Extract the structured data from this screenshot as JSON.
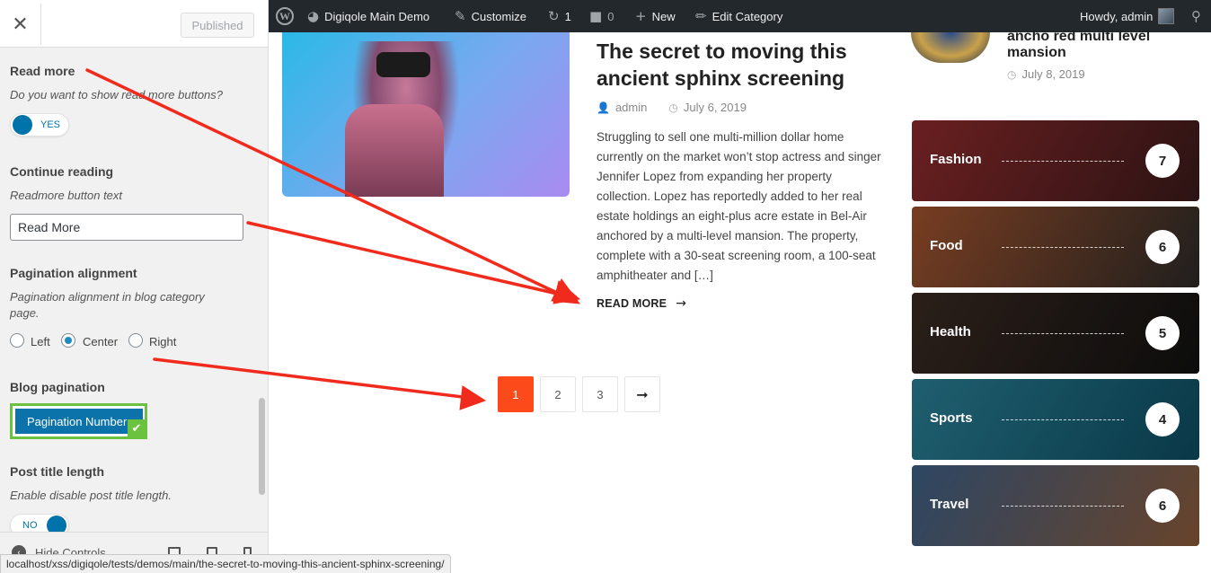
{
  "customizer": {
    "published_label": "Published",
    "sections": {
      "read_more": {
        "title": "Read more",
        "description": "Do you want to show read more buttons?",
        "toggle_label": "YES"
      },
      "continue_reading": {
        "title": "Continue reading",
        "description": "Readmore button text",
        "input_value": "Read More"
      },
      "pagination_alignment": {
        "title": "Pagination alignment",
        "description": "Pagination alignment in blog category page.",
        "options": [
          "Left",
          "Center",
          "Right"
        ],
        "selected": "Center"
      },
      "blog_pagination": {
        "title": "Blog pagination",
        "selected_label": "Pagination Number"
      },
      "post_title_length": {
        "title": "Post title length",
        "description": "Enable disable post title length.",
        "toggle_label": "NO"
      }
    },
    "footer": {
      "hide_controls": "Hide Controls"
    }
  },
  "adminbar": {
    "site_name": "Digiqole Main Demo",
    "customize": "Customize",
    "updates_count": "1",
    "comments_count": "0",
    "new_label": "New",
    "edit_label": "Edit Category",
    "howdy": "Howdy, admin"
  },
  "post": {
    "title": "The secret to moving this ancient sphinx screening",
    "author": "admin",
    "date": "July 6, 2019",
    "excerpt": "Struggling to sell one multi-million dollar home currently on the market won’t stop actress and singer Jennifer Lopez from expanding her property collection. Lopez has reportedly added to her real estate holdings an eight-plus acre estate in Bel-Air anchored by a multi-level mansion. The property, complete with a 30-seat screening room, a 100-seat amphitheater and […]",
    "read_more": "READ MORE"
  },
  "pagination": {
    "pages": [
      "1",
      "2",
      "3"
    ],
    "active": "1",
    "next_icon": "arrow-right-icon"
  },
  "sidebar": {
    "related": {
      "title": "ancho red multi level mansion",
      "date": "July 8, 2019"
    },
    "categories": [
      {
        "name": "Fashion",
        "count": "7",
        "color_a": "#8e2a2c",
        "color_b": "#3b1a1a"
      },
      {
        "name": "Food",
        "count": "6",
        "color_a": "#a0522d",
        "color_b": "#2c2a28"
      },
      {
        "name": "Health",
        "count": "5",
        "color_a": "#3a2a22",
        "color_b": "#111111"
      },
      {
        "name": "Sports",
        "count": "4",
        "color_a": "#2a7f95",
        "color_b": "#0d4c60"
      },
      {
        "name": "Travel",
        "count": "6",
        "color_a": "#3d5f85",
        "color_b": "#8b5a3a"
      }
    ]
  },
  "status_url": "localhost/xss/digiqole/tests/demos/main/the-secret-to-moving-this-ancient-sphinx-screening/",
  "colors": {
    "accent": "#0073aa",
    "pagination_active": "#fc4a1a",
    "highlight": "#6bc23f",
    "annotation_arrow": "#f02b1d"
  }
}
